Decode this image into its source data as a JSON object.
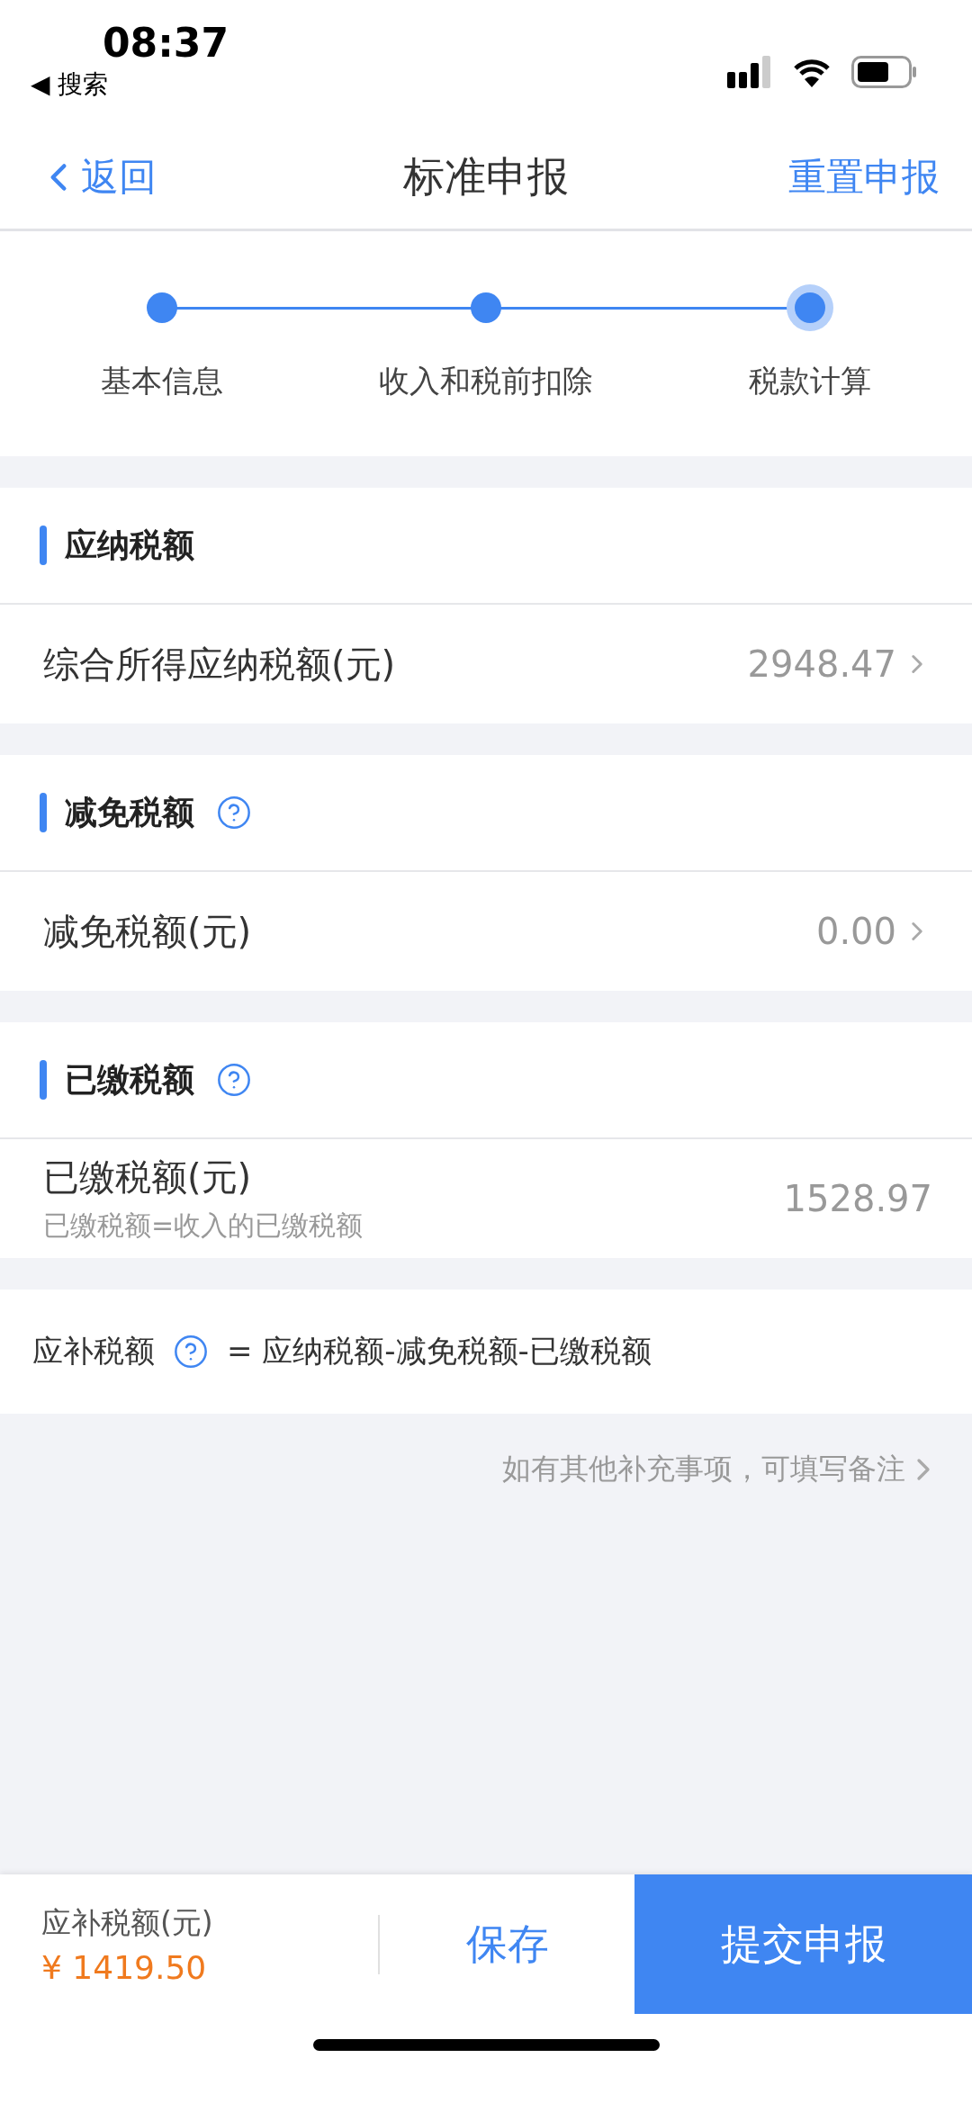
{
  "status_bar": {
    "time": "08:37",
    "back_app": "◀ 搜索"
  },
  "nav": {
    "back": "返回",
    "title": "标准申报",
    "action": "重置申报"
  },
  "steps": [
    {
      "label": "基本信息",
      "selected": false
    },
    {
      "label": "收入和税前扣除",
      "selected": false
    },
    {
      "label": "税款计算",
      "selected": true
    }
  ],
  "sections": [
    {
      "title": "应纳税额",
      "help": false,
      "rows": [
        {
          "label": "综合所得应纳税额(元)",
          "value": "2948.47",
          "chevron": true
        }
      ]
    },
    {
      "title": "减免税额",
      "help": true,
      "rows": [
        {
          "label": "减免税额(元)",
          "value": "0.00",
          "chevron": true
        }
      ]
    },
    {
      "title": "已缴税额",
      "help": true,
      "rows": [
        {
          "label": "已缴税额(元)",
          "sub": "已缴税额=收入的已缴税额",
          "value": "1528.97",
          "chevron": false
        }
      ]
    }
  ],
  "formula": {
    "label": "应补税额",
    "expression": "= 应纳税额-减免税额-已缴税额"
  },
  "note": "如有其他补充事项，可填写备注",
  "footer": {
    "label": "应补税额(元)",
    "amount": "¥ 1419.50",
    "save": "保存",
    "submit": "提交申报"
  }
}
